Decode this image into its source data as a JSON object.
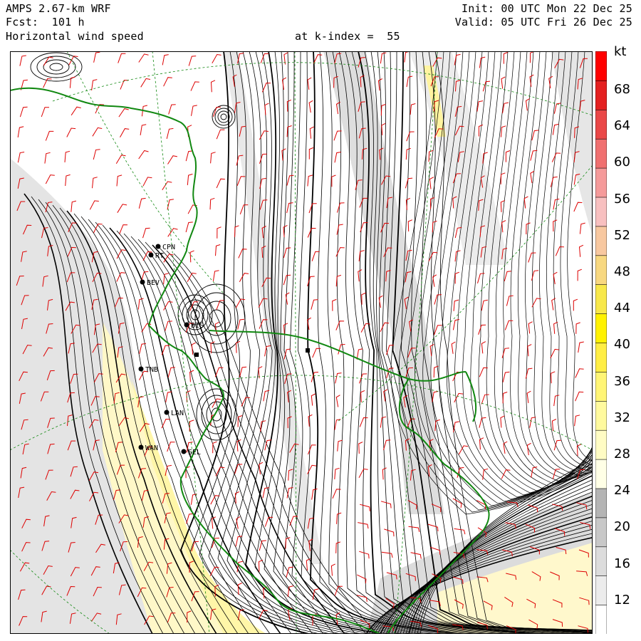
{
  "header": {
    "model": "AMPS 2.67-km WRF",
    "forecast": "Fcst:  101 h",
    "field": "Horizontal wind speed",
    "level": "at k-index =  55",
    "init": "Init: 00 UTC Mon 22 Dec 25",
    "valid": "Valid: 05 UTC Fri 26 Dec 25"
  },
  "colorbar": {
    "unit": "kt",
    "ticks": [
      "68",
      "64",
      "60",
      "56",
      "52",
      "48",
      "44",
      "40",
      "36",
      "32",
      "28",
      "24",
      "20",
      "16",
      "12"
    ],
    "colors": [
      "#ffffff",
      "#ececec",
      "#dcdcdc",
      "#c8c8c8",
      "#b4b4b4",
      "#ffffe6",
      "#fffcc4",
      "#fffa9e",
      "#fff575",
      "#ffee44",
      "#fff200",
      "#f8e84a",
      "#f8d880",
      "#f8c8a0",
      "#f8c0c0",
      "#f59a9a",
      "#f07070",
      "#ea4848",
      "#e42020",
      "#ff0000"
    ]
  },
  "stations": [
    {
      "label": "CPN",
      "icon": "station-dot-icon"
    },
    {
      "label": "RT",
      "icon": "station-dot-icon"
    },
    {
      "label": "BEV",
      "icon": "station-dot-icon"
    },
    {
      "label": "BIS",
      "icon": "station-dot-icon"
    },
    {
      "label": "TNB",
      "icon": "station-dot-icon"
    },
    {
      "label": "LAN",
      "icon": "station-dot-icon"
    },
    {
      "label": "WAN",
      "icon": "station-dot-icon"
    },
    {
      "label": "SEL",
      "icon": "station-dot-icon"
    }
  ],
  "colors": {
    "coastline": "#118811",
    "barbs": "#dd0000",
    "grid": "#118811",
    "contour": "#000000"
  }
}
